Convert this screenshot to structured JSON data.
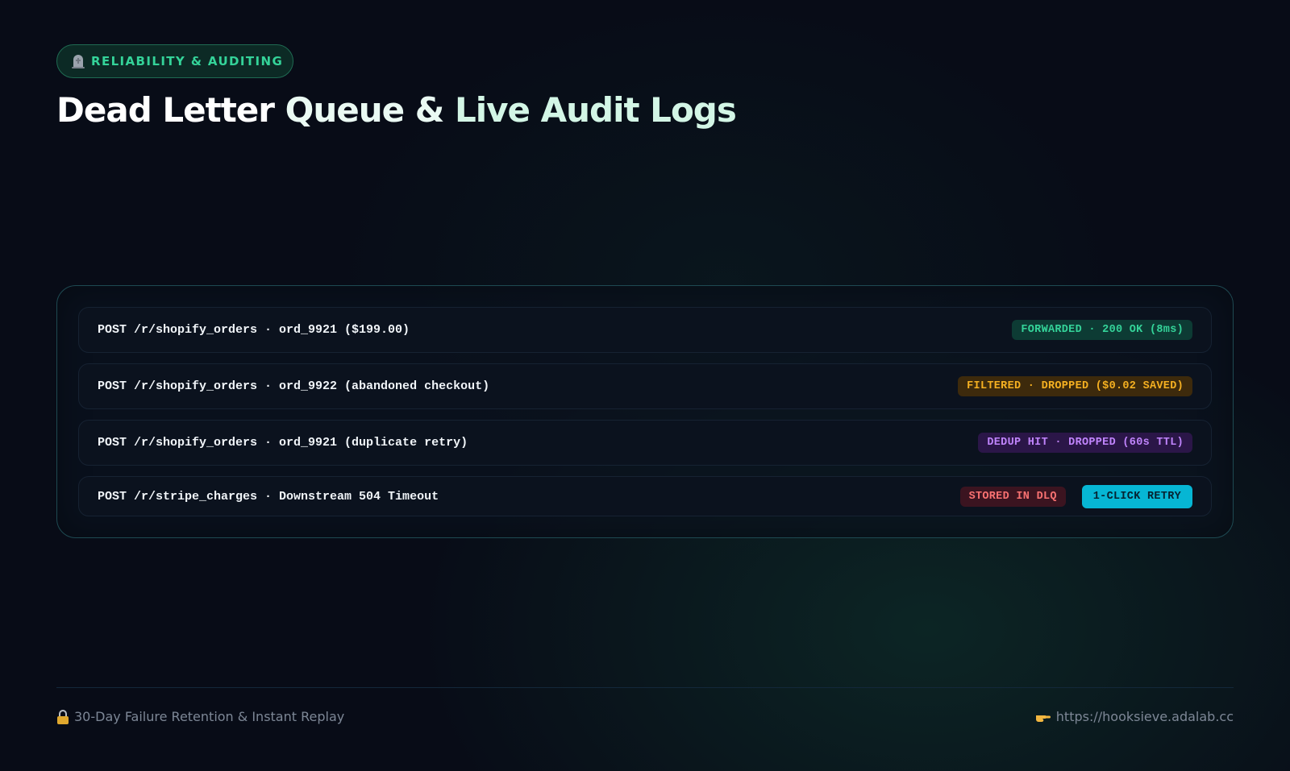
{
  "badge": {
    "icon": "tombstone-icon",
    "label": "RELIABILITY & AUDITING"
  },
  "title": {
    "part1": "Dead Letter ",
    "part2": "Queue & ",
    "part3": "Live Audit Logs"
  },
  "logs": [
    {
      "text": "POST /r/shopify_orders · ord_9921 ($199.00)",
      "status": "FORWARDED · 200 OK (8ms)",
      "status_color": "#34d399"
    },
    {
      "text": "POST /r/shopify_orders · ord_9922 (abandoned checkout)",
      "status": "FILTERED · DROPPED ($0.02 SAVED)",
      "status_color": "#f5b021"
    },
    {
      "text": "POST /r/shopify_orders · ord_9921 (duplicate retry)",
      "status": "DEDUP HIT · DROPPED (60s TTL)",
      "status_color": "#c084fc"
    },
    {
      "text": "POST /r/stripe_charges · Downstream 504 Timeout",
      "status": "STORED IN DLQ",
      "status_color": "#f87171",
      "action": "1-CLICK RETRY"
    }
  ],
  "footer": {
    "left_icon": "lock-icon",
    "left_text": "30-Day Failure Retention & Instant Replay",
    "right_icon": "pointing-hand-icon",
    "right_text": "https://hooksieve.adalab.cc"
  },
  "colors": {
    "background": "#080c17",
    "accent": "#34d399",
    "retry_button": "#06b6d4"
  }
}
